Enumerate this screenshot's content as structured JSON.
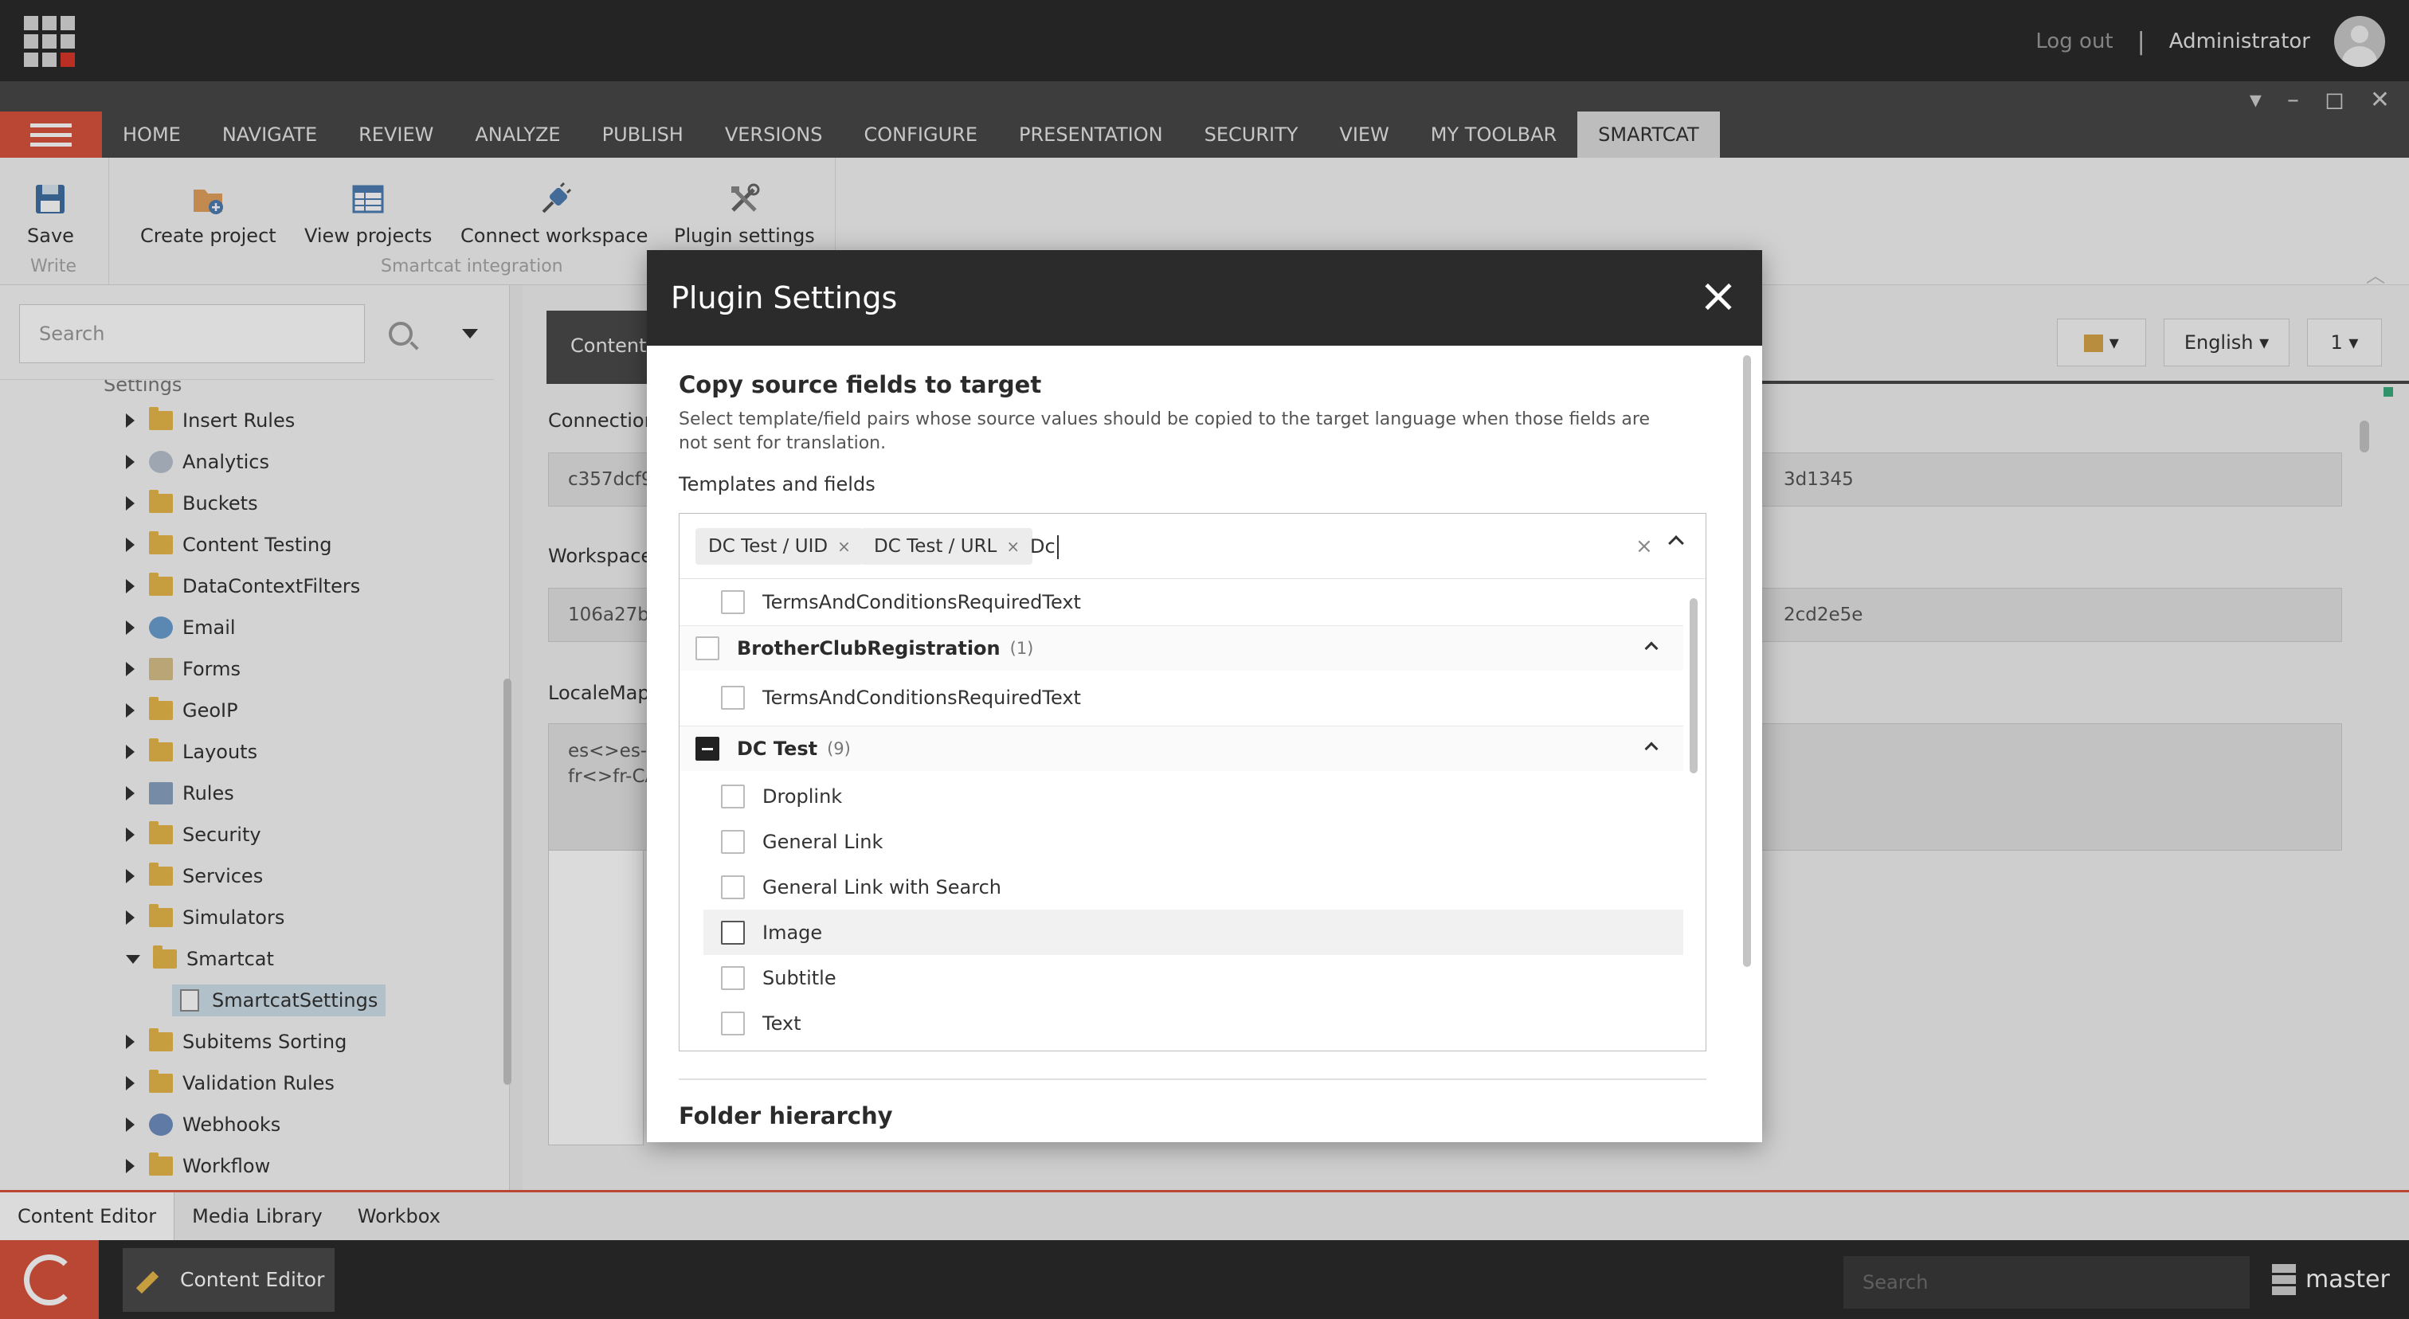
{
  "header": {
    "logout": "Log out",
    "separator": "|",
    "user": "Administrator"
  },
  "ribbon_tabs": [
    "HOME",
    "NAVIGATE",
    "REVIEW",
    "ANALYZE",
    "PUBLISH",
    "VERSIONS",
    "CONFIGURE",
    "PRESENTATION",
    "SECURITY",
    "VIEW",
    "MY TOOLBAR",
    "SMARTCAT"
  ],
  "active_tab": "SMARTCAT",
  "ribbon": {
    "save": "Save",
    "write_group": "Write",
    "create_project": "Create project",
    "view_projects": "View projects",
    "connect_workspace": "Connect workspace",
    "plugin_settings": "Plugin settings",
    "integration_group": "Smartcat integration"
  },
  "left": {
    "search_placeholder": "Search",
    "parent_label": "Settings",
    "tree": [
      "Insert Rules",
      "Analytics",
      "Buckets",
      "Content Testing",
      "DataContextFilters",
      "Email",
      "Forms",
      "GeoIP",
      "Layouts",
      "Rules",
      "Security",
      "Services",
      "Simulators",
      "Smartcat",
      "SmartcatSettings",
      "Subitems Sorting",
      "Validation Rules",
      "Webhooks",
      "Workflow"
    ]
  },
  "content": {
    "tab": "Content",
    "language": "English",
    "version": "1",
    "connection_label": "Connection",
    "connection_value": "c357dcf9",
    "connection_tail": "3d1345",
    "workspace_label": "Workspace",
    "workspace_value": "106a27b",
    "workspace_tail": "2cd2e5e",
    "locale_label": "LocaleMap",
    "locale_value": "es<>es-U\nfr<>fr-CA"
  },
  "modal": {
    "title": "Plugin Settings",
    "section_title": "Copy source fields to target",
    "section_desc": "Select template/field pairs whose source values should be copied to the target language when those fields are not sent for translation.",
    "templates_label": "Templates and fields",
    "chips": [
      "DC Test / UID",
      "DC Test / URL"
    ],
    "chip_remove": "×",
    "query": "Dc",
    "clear": "×",
    "options": {
      "row0": "TermsAndConditionsRequiredText",
      "group1": "BrotherClubRegistration",
      "group1_count": "(1)",
      "row1": "TermsAndConditionsRequiredText",
      "group2": "DC Test",
      "group2_count": "(9)",
      "children": [
        "Droplink",
        "General Link",
        "General Link with Search",
        "Image",
        "Subtitle",
        "Text"
      ]
    },
    "next_section": "Folder hierarchy"
  },
  "bottom": {
    "tabs": [
      "Content Editor",
      "Media Library",
      "Workbox"
    ],
    "app": "Content Editor",
    "search_placeholder": "Search",
    "database": "master"
  }
}
